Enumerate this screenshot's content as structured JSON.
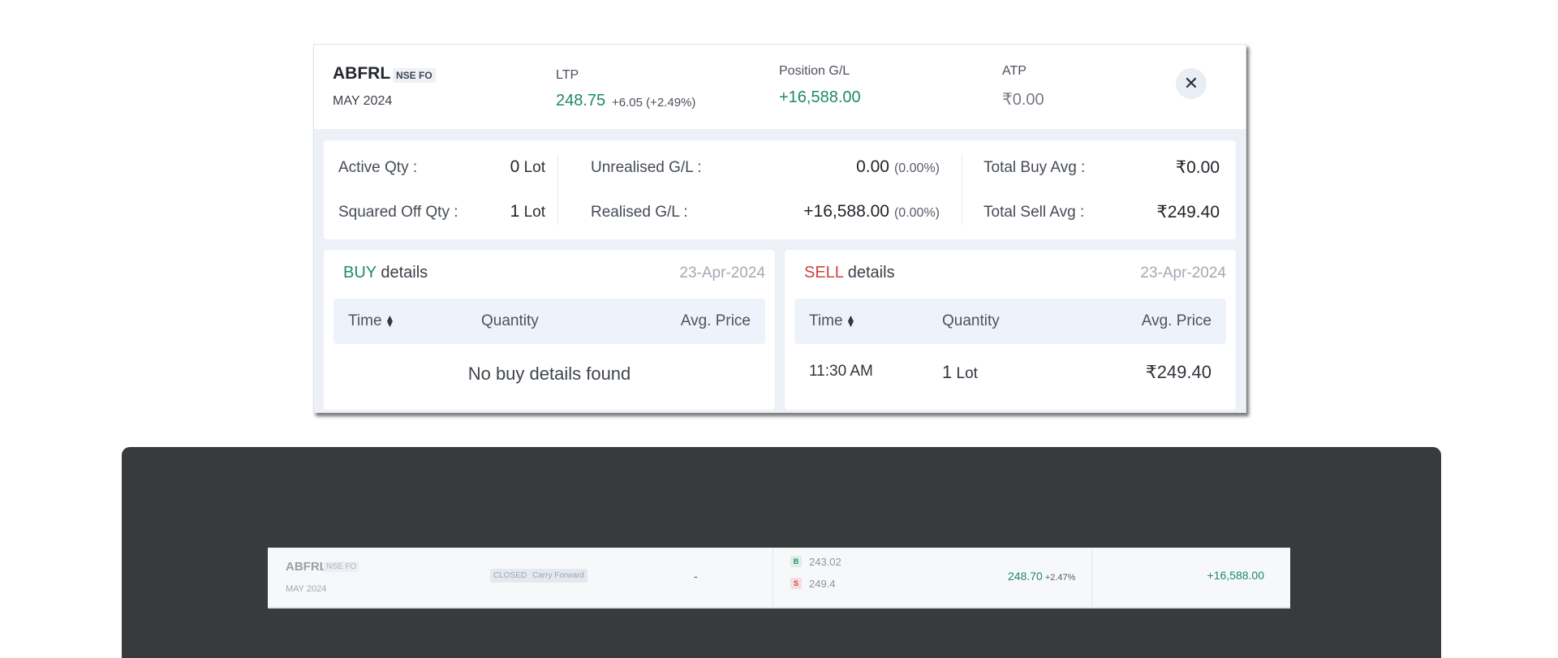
{
  "header": {
    "symbol": "ABFRL",
    "exchange": "NSE FO",
    "expiry": "MAY 2024",
    "ltp_label": "LTP",
    "ltp_value": "248.75",
    "ltp_change": "+6.05 (+2.49%)",
    "position_gl_label": "Position G/L",
    "position_gl_value": "+16,588.00",
    "atp_label": "ATP",
    "atp_value": "₹0.00",
    "close_icon": "close-icon"
  },
  "summary": {
    "active_qty_label": "Active Qty :",
    "active_qty_value": "0",
    "squared_off_qty_label": "Squared Off Qty :",
    "squared_off_qty_value": "1",
    "lot_unit": "Lot",
    "unrealised_gl_label": "Unrealised G/L :",
    "unrealised_gl_value": "0.00",
    "unrealised_gl_pct": "(0.00%)",
    "realised_gl_label": "Realised G/L :",
    "realised_gl_value": "+16,588.00",
    "realised_gl_pct": "(0.00%)",
    "total_buy_avg_label": "Total Buy Avg :",
    "total_buy_avg_value": "₹0.00",
    "total_sell_avg_label": "Total Sell Avg :",
    "total_sell_avg_value": "₹249.40"
  },
  "buy_panel": {
    "title_highlight": "BUY",
    "title_rest": "details",
    "date": "23-Apr-2024",
    "columns": [
      "Time",
      "Quantity",
      "Avg. Price"
    ],
    "empty_message": "No buy details found"
  },
  "sell_panel": {
    "title_highlight": "SELL",
    "title_rest": "details",
    "date": "23-Apr-2024",
    "columns": [
      "Time",
      "Quantity",
      "Avg. Price"
    ],
    "rows": [
      {
        "time": "11:30 AM",
        "quantity": "1",
        "unit": "Lot",
        "avg_price": "₹249.40"
      }
    ]
  },
  "position_row": {
    "symbol": "ABFRL",
    "exchange": "NSE FO",
    "expiry": "MAY 2024",
    "status": "CLOSED",
    "product": "Carry Forward",
    "qty": "-",
    "buy_badge": "B",
    "buy_avg": "243.02",
    "sell_badge": "S",
    "sell_avg": "249.4",
    "ltp": "248.70",
    "ltp_change": "+2.47%",
    "pl": "+16,588.00"
  },
  "colors": {
    "positive": "#1d8a6a",
    "negative": "#cf4242",
    "backdrop": "#393a3b",
    "card_bg": "#edf0f6"
  }
}
